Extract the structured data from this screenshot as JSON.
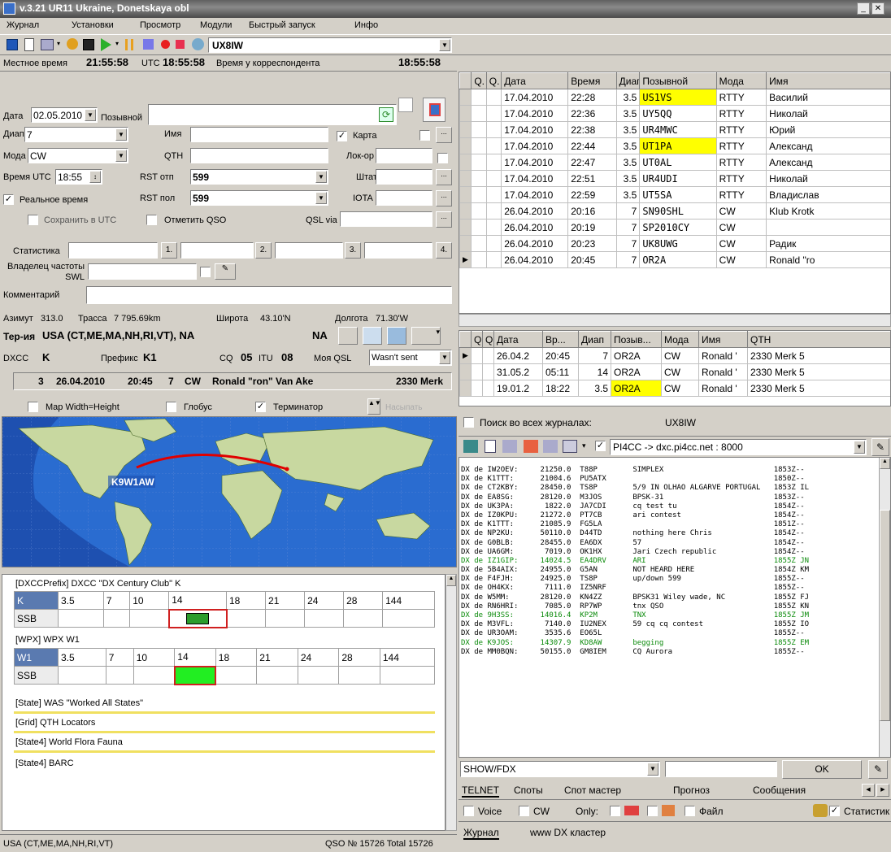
{
  "window": {
    "title": "v.3.21   UR11 Ukraine, Donetskaya obl"
  },
  "menu": [
    "Журнал",
    "Установки",
    "Просмотр",
    "Модули",
    "Быстрый запуск",
    "Инфо"
  ],
  "toolbar": {
    "callsign": "UX8IW"
  },
  "clock": {
    "local_label": "Местное время",
    "local": "21:55:58",
    "utc_label": "UTC",
    "utc": "18:55:58",
    "corr_label": "Время у корреспондента",
    "corr": "18:55:58"
  },
  "form": {
    "date_label": "Дата",
    "date": "02.05.2010",
    "callsign_label": "Позывной",
    "band_label": "Диап",
    "band": "7",
    "name_label": "Имя",
    "map_label": "Карта",
    "mode_label": "Мода",
    "mode": "CW",
    "qth_label": "QTH",
    "locator_label": "Лок-ор",
    "time_label": "Время UTC",
    "time": "18:55",
    "rst_sent_label": "RST отп",
    "rst_sent": "599",
    "state_label": "Штат",
    "realtime_label": "Реальное время",
    "rst_rcvd_label": "RST пол",
    "rst_rcvd": "599",
    "iota_label": "IOTA",
    "save_utc_label": "Сохранить в UTC",
    "mark_qso_label": "Отметить QSO",
    "qsl_via_label": "QSL via",
    "stats_label": "Статистика",
    "stat_buttons": [
      "1.",
      "2.",
      "3.",
      "4."
    ],
    "swl_label": "Владелец частоты SWL",
    "comment_label": "Комментарий"
  },
  "geo": {
    "azimuth_label": "Азимут",
    "azimuth": "313.0",
    "path_label": "Трасса",
    "path": "7 795.69km",
    "lat_label": "Широта",
    "lat": "43.10'N",
    "lon_label": "Долгота",
    "lon": "71.30'W",
    "territory_label": "Тер-ия",
    "territory": "USA (CT,ME,MA,NH,RI,VT), NA",
    "continent": "NA",
    "dxcc_label": "DXCC",
    "dxcc": "K",
    "prefix_label": "Префикс",
    "prefix": "K1",
    "cq_label": "CQ",
    "cq": "05",
    "itu_label": "ITU",
    "itu": "08",
    "myqsl_label": "Моя QSL",
    "myqsl": "Wasn't sent"
  },
  "last_qso": {
    "n": "3",
    "date": "26.04.2010",
    "time": "20:45",
    "band": "7",
    "mode": "CW",
    "name": "Ronald \"ron\" Van Ake",
    "qth": "2330 Merk"
  },
  "map_opts": {
    "width_height": "Map Width=Height",
    "globe": "Глобус",
    "terminator": "Терминатор",
    "extra": "Насыпать"
  },
  "map": {
    "station_label": "K9W1AW"
  },
  "awards": {
    "dxcc_title": "[DXCCPrefix] DXCC \"DX Century Club\" K",
    "dxcc_row_label": "K",
    "wpx_title": "[WPX] WPX W1",
    "wpx_row_label": "W1",
    "bands": [
      "3.5",
      "7",
      "10",
      "14",
      "18",
      "21",
      "24",
      "28",
      "144"
    ],
    "mode": "SSB",
    "was_title": "[State] WAS \"Worked All States\"",
    "grid_title": "[Grid] QTH Locators",
    "state4_title": "[State4] World Flora Fauna",
    "more_title": "[State4] BARC"
  },
  "status": {
    "territory": "USA (CT,ME,MA,NH,RI,VT)",
    "qso": "QSO № 15726 Total 15726"
  },
  "log": {
    "columns": [
      "Q.",
      "Q.",
      "Дата",
      "Время",
      "Диап",
      "Позывной",
      "Мода",
      "Имя"
    ],
    "rows": [
      {
        "date": "17.04.2010",
        "time": "22:28",
        "band": "3.5",
        "call": "US1VS",
        "mode": "RTTY",
        "name": "Василий",
        "hl": true
      },
      {
        "date": "17.04.2010",
        "time": "22:36",
        "band": "3.5",
        "call": "UY5QQ",
        "mode": "RTTY",
        "name": "Николай",
        "hl": false
      },
      {
        "date": "17.04.2010",
        "time": "22:38",
        "band": "3.5",
        "call": "UR4MWC",
        "mode": "RTTY",
        "name": "Юрий",
        "hl": false
      },
      {
        "date": "17.04.2010",
        "time": "22:44",
        "band": "3.5",
        "call": "UT1PA",
        "mode": "RTTY",
        "name": "Александ",
        "hl": true
      },
      {
        "date": "17.04.2010",
        "time": "22:47",
        "band": "3.5",
        "call": "UT0AL",
        "mode": "RTTY",
        "name": "Александ",
        "hl": false
      },
      {
        "date": "17.04.2010",
        "time": "22:51",
        "band": "3.5",
        "call": "UR4UDI",
        "mode": "RTTY",
        "name": "Николай",
        "hl": false
      },
      {
        "date": "17.04.2010",
        "time": "22:59",
        "band": "3.5",
        "call": "UT5SA",
        "mode": "RTTY",
        "name": "Владислав",
        "hl": false
      },
      {
        "date": "26.04.2010",
        "time": "20:16",
        "band": "7",
        "call": "SN90SHL",
        "mode": "CW",
        "name": "Klub Krotk",
        "hl": false
      },
      {
        "date": "26.04.2010",
        "time": "20:19",
        "band": "7",
        "call": "SP2010CY",
        "mode": "CW",
        "name": "",
        "hl": false
      },
      {
        "date": "26.04.2010",
        "time": "20:23",
        "band": "7",
        "call": "UK8UWG",
        "mode": "CW",
        "name": "Радик",
        "hl": false
      },
      {
        "date": "26.04.2010",
        "time": "20:45",
        "band": "7",
        "call": "OR2A",
        "mode": "CW",
        "name": "Ronald \"ro",
        "hl": false
      }
    ]
  },
  "history": {
    "columns": [
      "Q",
      "Q",
      "Дата",
      "Вр...",
      "Диап",
      "Позыв...",
      "Мода",
      "Имя",
      "QTH"
    ],
    "rows": [
      {
        "date": "26.04.2",
        "time": "20:45",
        "band": "7",
        "call": "OR2A",
        "mode": "CW",
        "name": "Ronald '",
        "qth": "2330 Merk 5",
        "hl": false
      },
      {
        "date": "31.05.2",
        "time": "05:11",
        "band": "14",
        "call": "OR2A",
        "mode": "CW",
        "name": "Ronald '",
        "qth": "2330 Merk 5",
        "hl": false
      },
      {
        "date": "19.01.2",
        "time": "18:22",
        "band": "3.5",
        "call": "OR2A",
        "mode": "CW",
        "name": "Ronald '",
        "qth": "2330 Merk 5",
        "hl": true
      }
    ]
  },
  "search": {
    "label": "Поиск во всех журналах:",
    "value": "UX8IW"
  },
  "cluster": {
    "server": "PI4CC -> dxc.pi4cc.net : 8000",
    "lines": [
      {
        "t": "DX de IW2OEV:     21250.0  T88P        SIMPLEX                         1853Z--",
        "g": false
      },
      {
        "t": "DX de K1TTT:      21004.6  PU5ATX                                      1850Z--",
        "g": false
      },
      {
        "t": "DX de CT2KBY:     28450.0  TS8P        5/9 IN OLHAO ALGARVE PORTUGAL   1853Z IL",
        "g": false
      },
      {
        "t": "DX de EA8SG:      28120.0  M3JOS       BPSK-31                         1853Z--",
        "g": false
      },
      {
        "t": "DX de UK3PA:       1822.0  JA7CDI      cq test tu                      1854Z--",
        "g": false
      },
      {
        "t": "DX de IZ0KPU:     21272.0  PT7CB       ari contest                     1854Z--",
        "g": false
      },
      {
        "t": "DX de K1TTT:      21085.9  FG5LA                                       1851Z--",
        "g": false
      },
      {
        "t": "DX de NP2KU:      50110.0  D44TD       nothing here Chris              1854Z--",
        "g": false
      },
      {
        "t": "DX de G0BLB:      28455.0  EA6DX       57                              1854Z--",
        "g": false
      },
      {
        "t": "DX de UA6GM:       7019.0  OK1HX       Jari Czech republic             1854Z--",
        "g": false
      },
      {
        "t": "DX de IZ1GIP:     14024.5  EA4DRV      ARI                             1855Z JN",
        "g": true
      },
      {
        "t": "DX de 5B4AIX:     24955.0  G5AN        NOT HEARD HERE                  1854Z KM",
        "g": false
      },
      {
        "t": "DX de F4FJH:      24925.0  TS8P        up/down 599                     1855Z--",
        "g": false
      },
      {
        "t": "DX de OH4KX:       7111.0  IZ5NRF                                      1855Z--",
        "g": false
      },
      {
        "t": "DX de W5MM:       28120.0  KN4ZZ       BPSK31 Wiley wade, NC           1855Z FJ",
        "g": false
      },
      {
        "t": "DX de RN6HRI:      7085.0  RP7WP       tnx QSO                         1855Z KN",
        "g": false
      },
      {
        "t": "DX de 9H3SS:      14016.4  KP2M        TNX                             1855Z JM",
        "g": true
      },
      {
        "t": "DX de M3VFL:       7140.0  IU2NEX      59 cq cq contest                1855Z IO",
        "g": false
      },
      {
        "t": "DX de UR3OAM:      3535.6  EO65L                                       1855Z--",
        "g": false
      },
      {
        "t": "DX de K9JOS:      14307.9  KD8AW       begging                         1855Z EM",
        "g": true
      },
      {
        "t": "DX de MM0BQN:     50155.0  GM8IEM      CQ Aurora                       1855Z--",
        "g": false
      }
    ],
    "command": "SHOW/FDX",
    "ok": "OK",
    "tabs": [
      "TELNET",
      "Споты",
      "Спот мастер",
      "Прогноз",
      "Сообщения"
    ],
    "voice": "Voice",
    "cw": "CW",
    "only": "Only:",
    "file": "Файл",
    "stats": "Статистик"
  },
  "bottom_tabs": [
    "Журнал",
    "www DX кластер"
  ]
}
